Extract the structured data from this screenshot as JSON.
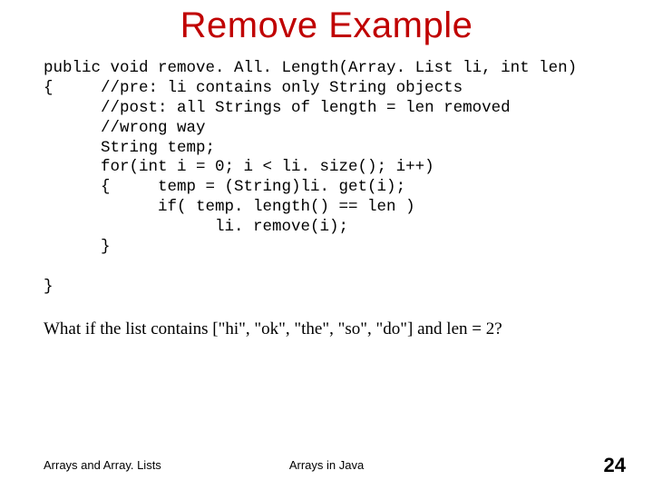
{
  "title": "Remove Example",
  "code": {
    "l1": "public void remove. All. Length(Array. List li, int len)",
    "l2": "{     //pre: li contains only String objects",
    "l3": "      //post: all Strings of length = len removed",
    "l4": "      //wrong way",
    "l5": "      String temp;",
    "l6": "      for(int i = 0; i < li. size(); i++)",
    "l7": "      {     temp = (String)li. get(i);",
    "l8": "            if( temp. length() == len )",
    "l9": "                  li. remove(i);",
    "l10": "      }",
    "l11": "",
    "l12": "}"
  },
  "question": "What if the list contains [\"hi\", \"ok\", \"the\", \"so\", \"do\"] and len = 2?",
  "footer_left": "Arrays and Array. Lists",
  "footer_center": "Arrays in Java",
  "page_number": "24"
}
